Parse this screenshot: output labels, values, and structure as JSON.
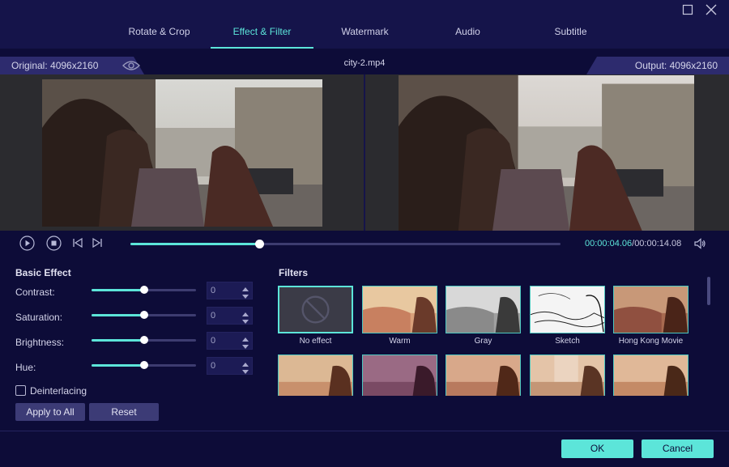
{
  "window": {
    "maximize_icon": "maximize-icon",
    "close_icon": "close-icon"
  },
  "tabs": [
    {
      "label": "Rotate & Crop"
    },
    {
      "label": "Effect & Filter",
      "active": true
    },
    {
      "label": "Watermark"
    },
    {
      "label": "Audio"
    },
    {
      "label": "Subtitle"
    }
  ],
  "preview": {
    "original_label": "Original: 4096x2160",
    "output_label": "Output: 4096x2160",
    "filename": "city-2.mp4"
  },
  "playback": {
    "current_time": "00:00:04.06",
    "separator": "/",
    "total_time": "00:00:14.08",
    "progress": 0.3
  },
  "basic_effect": {
    "title": "Basic Effect",
    "adjustments": [
      {
        "label": "Contrast:",
        "value": "0",
        "level": 0.5
      },
      {
        "label": "Saturation:",
        "value": "0",
        "level": 0.5
      },
      {
        "label": "Brightness:",
        "value": "0",
        "level": 0.5
      },
      {
        "label": "Hue:",
        "value": "0",
        "level": 0.5
      }
    ],
    "deinterlacing_label": "Deinterlacing",
    "apply_all_label": "Apply to All",
    "reset_label": "Reset"
  },
  "filters": {
    "title": "Filters",
    "row1": [
      {
        "label": "No effect"
      },
      {
        "label": "Warm"
      },
      {
        "label": "Gray"
      },
      {
        "label": "Sketch"
      },
      {
        "label": "Hong Kong Movie"
      }
    ]
  },
  "footer": {
    "ok_label": "OK",
    "cancel_label": "Cancel"
  },
  "colors": {
    "accent": "#5ce5d9",
    "background": "#0d0c38",
    "panel": "#15144a"
  }
}
